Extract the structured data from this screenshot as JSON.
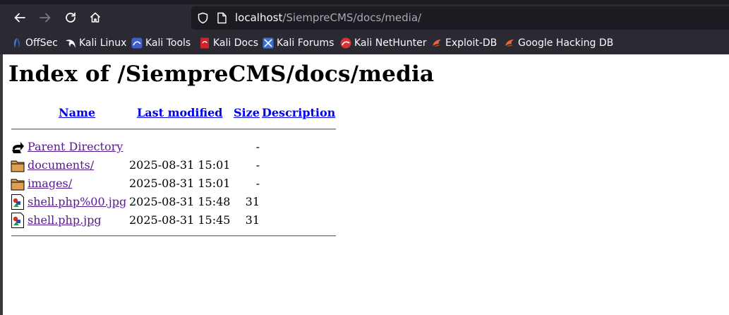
{
  "browser": {
    "url_host": "localhost",
    "url_path": "/SiempreCMS/docs/media/",
    "bookmarks": [
      {
        "label": "OffSec",
        "icon": "offsec-icon"
      },
      {
        "label": "Kali Linux",
        "icon": "kali-dragon-icon"
      },
      {
        "label": "Kali Tools",
        "icon": "kali-tools-icon"
      },
      {
        "label": "Kali Docs",
        "icon": "kali-docs-icon"
      },
      {
        "label": "Kali Forums",
        "icon": "kali-forums-icon"
      },
      {
        "label": "Kali NetHunter",
        "icon": "nethunter-icon"
      },
      {
        "label": "Exploit-DB",
        "icon": "exploitdb-icon"
      },
      {
        "label": "Google Hacking DB",
        "icon": "ghdb-icon"
      }
    ]
  },
  "page": {
    "title": "Index of /SiempreCMS/docs/media",
    "columns": {
      "name": "Name",
      "last_modified": "Last modified",
      "size": "Size",
      "description": "Description"
    },
    "rows": [
      {
        "name": "Parent Directory",
        "date": "",
        "size": "-",
        "icon": "parent-directory-icon"
      },
      {
        "name": "documents/",
        "date": "2025-08-31 15:01",
        "size": "-",
        "icon": "folder-icon"
      },
      {
        "name": "images/",
        "date": "2025-08-31 15:01",
        "size": "-",
        "icon": "folder-icon"
      },
      {
        "name": "shell.php%00.jpg",
        "date": "2025-08-31 15:48",
        "size": "31",
        "icon": "image-file-icon"
      },
      {
        "name": "shell.php.jpg",
        "date": "2025-08-31 15:45",
        "size": "31",
        "icon": "image-file-icon"
      }
    ]
  }
}
